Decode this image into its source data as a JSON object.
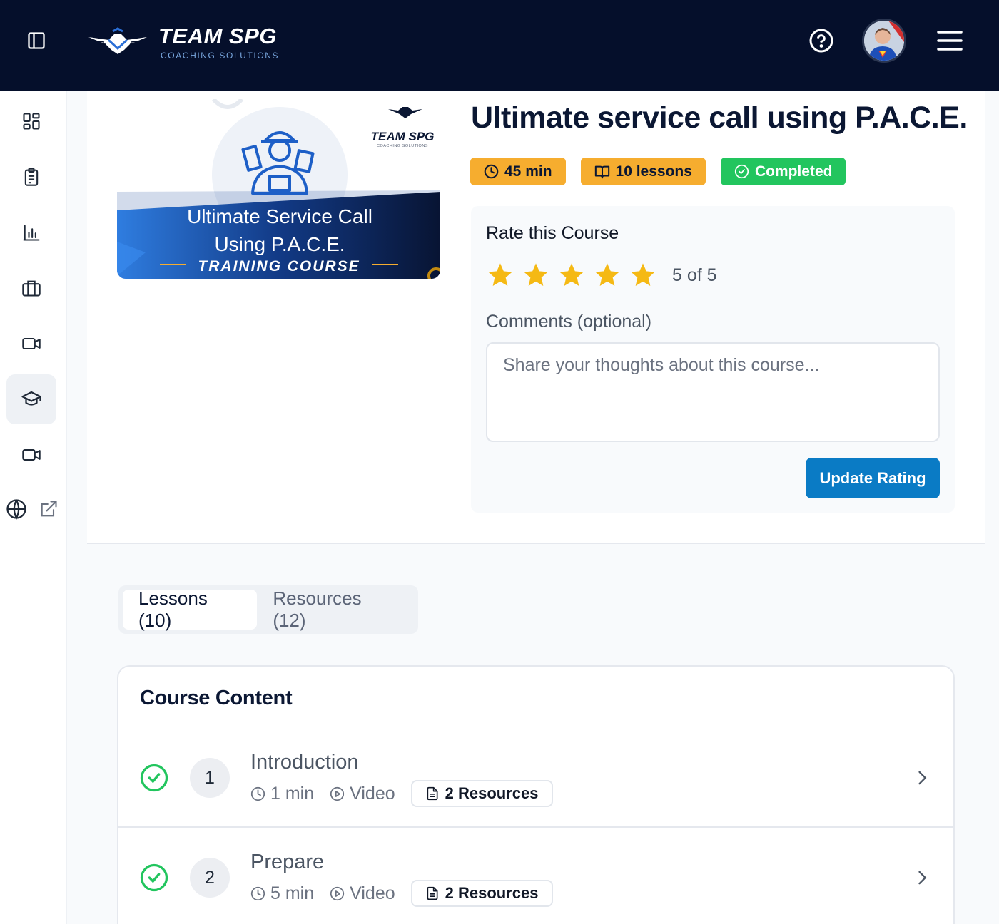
{
  "header": {
    "brand": "TEAM SPG",
    "tagline": "COACHING SOLUTIONS"
  },
  "course": {
    "thumbnail": {
      "logo_text": "TEAM SPG",
      "logo_sub": "COACHING SOLUTIONS",
      "line1": "Ultimate Service Call",
      "line2": "Using P.A.C.E.",
      "line3": "TRAINING COURSE"
    },
    "title": "Ultimate service call using P.A.C.E.",
    "badges": {
      "duration": "45 min",
      "lessons": "10 lessons",
      "status": "Completed"
    }
  },
  "rating": {
    "title": "Rate this Course",
    "value": 5,
    "max": 5,
    "value_text": "5 of 5",
    "comments_label": "Comments (optional)",
    "comments_placeholder": "Share your thoughts about this course...",
    "submit_label": "Update Rating"
  },
  "tabs": [
    {
      "label": "Lessons (10)"
    },
    {
      "label": "Resources (12)"
    }
  ],
  "content": {
    "heading": "Course Content",
    "lessons": [
      {
        "number": "1",
        "title": "Introduction",
        "duration": "1 min",
        "type": "Video",
        "resources": "2 Resources"
      },
      {
        "number": "2",
        "title": "Prepare",
        "duration": "5 min",
        "type": "Video",
        "resources": "2 Resources"
      }
    ]
  },
  "colors": {
    "topbar": "#050f2b",
    "badge_orange": "#f6ad2f",
    "badge_green": "#22c55e",
    "primary_button": "#0a7bc5",
    "star": "#f5b914"
  },
  "icons": {
    "sidebar": [
      "dashboard-icon",
      "clipboard-icon",
      "bar-chart-icon",
      "briefcase-icon",
      "video-camera-icon",
      "graduation-cap-icon",
      "video-camera-icon",
      "globe-icon",
      "external-link-icon"
    ]
  }
}
